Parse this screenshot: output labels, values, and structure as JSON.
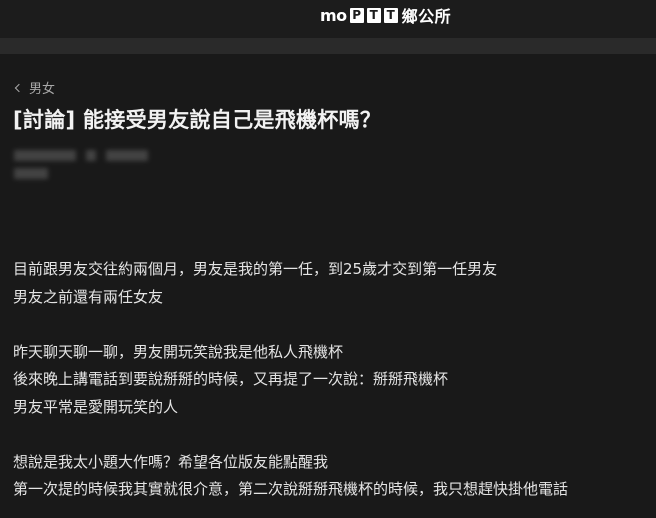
{
  "header": {
    "logo_mo": "mo",
    "logo_p": "P",
    "logo_t1": "T",
    "logo_t2": "T",
    "logo_cn": "鄉公所"
  },
  "breadcrumb": {
    "label": "男女"
  },
  "post": {
    "title": "[討論] 能接受男友說自己是飛機杯嗎？",
    "paragraphs": [
      [
        "目前跟男友交往約兩個月，男友是我的第一任，到25歲才交到第一任男友",
        "男友之前還有兩任女友"
      ],
      [
        "昨天聊天聊一聊，男友開玩笑說我是他私人飛機杯",
        "後來晚上講電話到要說掰掰的時候，又再提了一次說：掰掰飛機杯",
        "男友平常是愛開玩笑的人"
      ],
      [
        "想說是我太小題大作嗎？希望各位版友能點醒我",
        "第一次提的時候我其實就很介意，第二次說掰掰飛機杯的時候，我只想趕快掛他電話"
      ]
    ]
  },
  "colors": {
    "background": "#191919",
    "header": "#1c1c1c",
    "subbar": "#2a2a2a",
    "text": "#e4e4e4",
    "muted": "#a8a8a8"
  }
}
